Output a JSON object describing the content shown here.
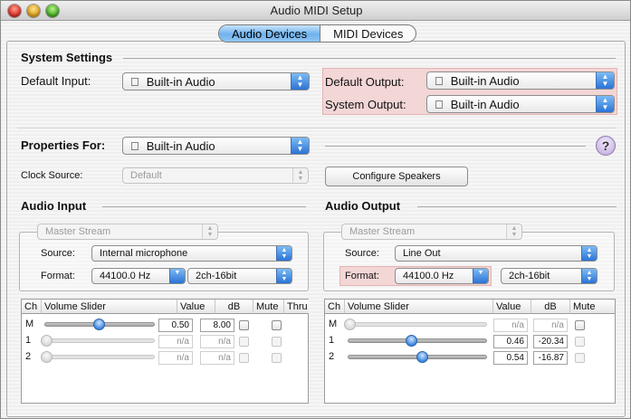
{
  "window": {
    "title": "Audio MIDI Setup"
  },
  "tabs": [
    {
      "label": "Audio Devices",
      "active": true
    },
    {
      "label": "MIDI Devices",
      "active": false
    }
  ],
  "system_settings": {
    "heading": "System Settings",
    "default_input_label": "Default Input:",
    "default_input_value": "Built-in Audio",
    "default_output_label": "Default Output:",
    "default_output_value": "Built-in Audio",
    "system_output_label": "System Output:",
    "system_output_value": "Built-in Audio"
  },
  "properties": {
    "label": "Properties For:",
    "value": "Built-in Audio",
    "clock_source_label": "Clock Source:",
    "clock_source_value": "Default",
    "configure_speakers": "Configure Speakers",
    "help_glyph": "?"
  },
  "audio_input": {
    "heading": "Audio Input",
    "stream": "Master Stream",
    "source_label": "Source:",
    "source_value": "Internal microphone",
    "format_label": "Format:",
    "format_rate": "44100.0 Hz",
    "format_bits": "2ch-16bit",
    "columns": [
      "Ch",
      "Volume Slider",
      "Value",
      "dB",
      "Mute",
      "Thru"
    ],
    "rows": [
      {
        "ch": "M",
        "value": "0.50",
        "db": "8.00",
        "slider": 0.5,
        "enabled": true
      },
      {
        "ch": "1",
        "value": "n/a",
        "db": "n/a",
        "slider": 0.0,
        "enabled": false
      },
      {
        "ch": "2",
        "value": "n/a",
        "db": "n/a",
        "slider": 0.0,
        "enabled": false
      }
    ]
  },
  "audio_output": {
    "heading": "Audio Output",
    "stream": "Master Stream",
    "source_label": "Source:",
    "source_value": "Line Out",
    "format_label": "Format:",
    "format_rate": "44100.0 Hz",
    "format_bits": "2ch-16bit",
    "columns": [
      "Ch",
      "Volume Slider",
      "Value",
      "dB",
      "Mute"
    ],
    "rows": [
      {
        "ch": "M",
        "value": "n/a",
        "db": "n/a",
        "slider": 0.0,
        "enabled": false
      },
      {
        "ch": "1",
        "value": "0.46",
        "db": "-20.34",
        "slider": 0.46,
        "enabled": true
      },
      {
        "ch": "2",
        "value": "0.54",
        "db": "-16.87",
        "slider": 0.54,
        "enabled": true
      }
    ]
  },
  "colors": {
    "highlight": "#f3d6d6",
    "popup_arrow": "#2a73d6",
    "tab_active": "#6fb2ee"
  }
}
